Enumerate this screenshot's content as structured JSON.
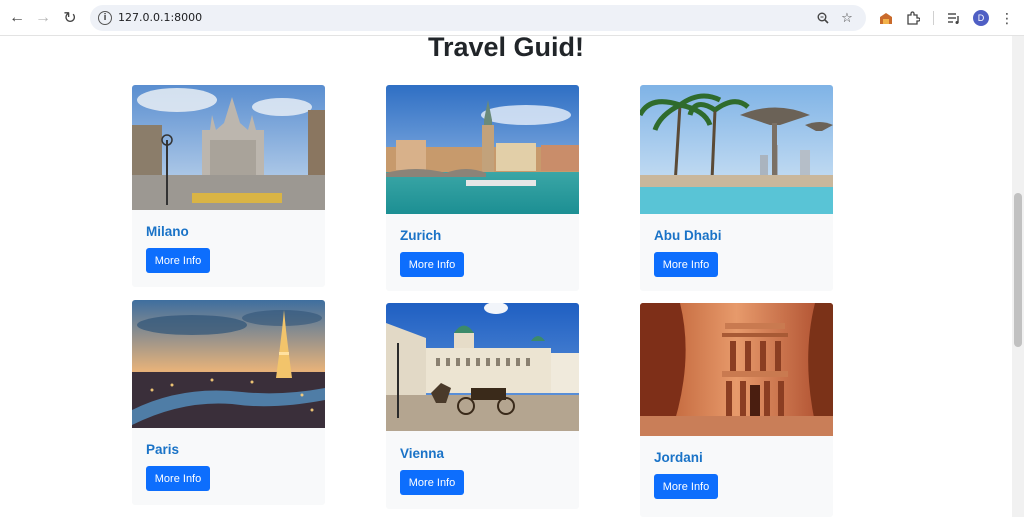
{
  "browser": {
    "url": "127.0.0.1:8000",
    "avatar_letter": "D"
  },
  "page": {
    "title": "Travel Guid!"
  },
  "cards": [
    {
      "name": "Milano",
      "button": "More Info"
    },
    {
      "name": "Zurich",
      "button": "More Info"
    },
    {
      "name": "Abu Dhabi",
      "button": "More Info"
    },
    {
      "name": "Paris",
      "button": "More Info"
    },
    {
      "name": "Vienna",
      "button": "More Info"
    },
    {
      "name": "Jordani",
      "button": "More Info"
    }
  ],
  "colors": {
    "button": "#0d6efd",
    "card_title": "#1a73c7",
    "card_bg": "#f8f9fa"
  }
}
